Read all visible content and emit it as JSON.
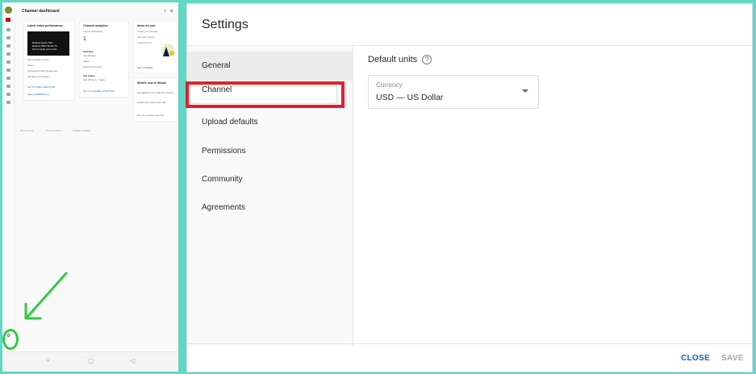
{
  "left": {
    "title": "Channel dashboard",
    "latest_video": {
      "title": "Latest video performance",
      "thumb_lines": [
        "Realme Narzo 50A",
        "Realme PRO Smart TV",
        "how to keep your mind..."
      ],
      "stats": [
        "First 20 days 2 hours",
        "Views",
        "Impressions click-through rate",
        "Average view duration"
      ],
      "link1": "GO TO VIDEO ANALYTICS",
      "link2": "SEE COMMENTS (1)"
    },
    "analytics": {
      "title": "Channel analytics",
      "sub": "Current subscribers",
      "count": "1",
      "summary": "Summary",
      "summary_sub": "Last 28 days",
      "rows": [
        "Views",
        "Watch time (hours)"
      ],
      "top_videos": "Top videos",
      "top_sub": "Last 48 hours · Views",
      "link": "GO TO CHANNEL ANALYTICS"
    },
    "ideas": {
      "title": "Ideas for you",
      "lines": [
        "Instant your channel",
        "Give your viewers",
        "a good look at"
      ],
      "link": "GET STARTED"
    },
    "whats_new": {
      "title": "What's new in Studio",
      "lines": [
        "Got ideas for your channel in Studio",
        "Instant your privacy and safe",
        "See an overview of growth"
      ]
    },
    "footer_links": [
      "Terms of use",
      "Privacy policy",
      "Policies & Safety"
    ]
  },
  "settings": {
    "title": "Settings",
    "nav": [
      "General",
      "Channel",
      "Upload defaults",
      "Permissions",
      "Community",
      "Agreements"
    ],
    "section_title": "Default units",
    "help_glyph": "?",
    "currency_label": "Currency",
    "currency_value": "USD — US Dollar",
    "close_label": "CLOSE",
    "save_label": "SAVE"
  },
  "colors": {
    "frame": "#62d7c6",
    "highlight": "#e0202d",
    "annotation_green": "#2ecc40",
    "primary": "#065fd4"
  },
  "icons": {
    "settings_gear": "gear-icon",
    "help": "help-icon",
    "dropdown": "caret-down-icon"
  }
}
